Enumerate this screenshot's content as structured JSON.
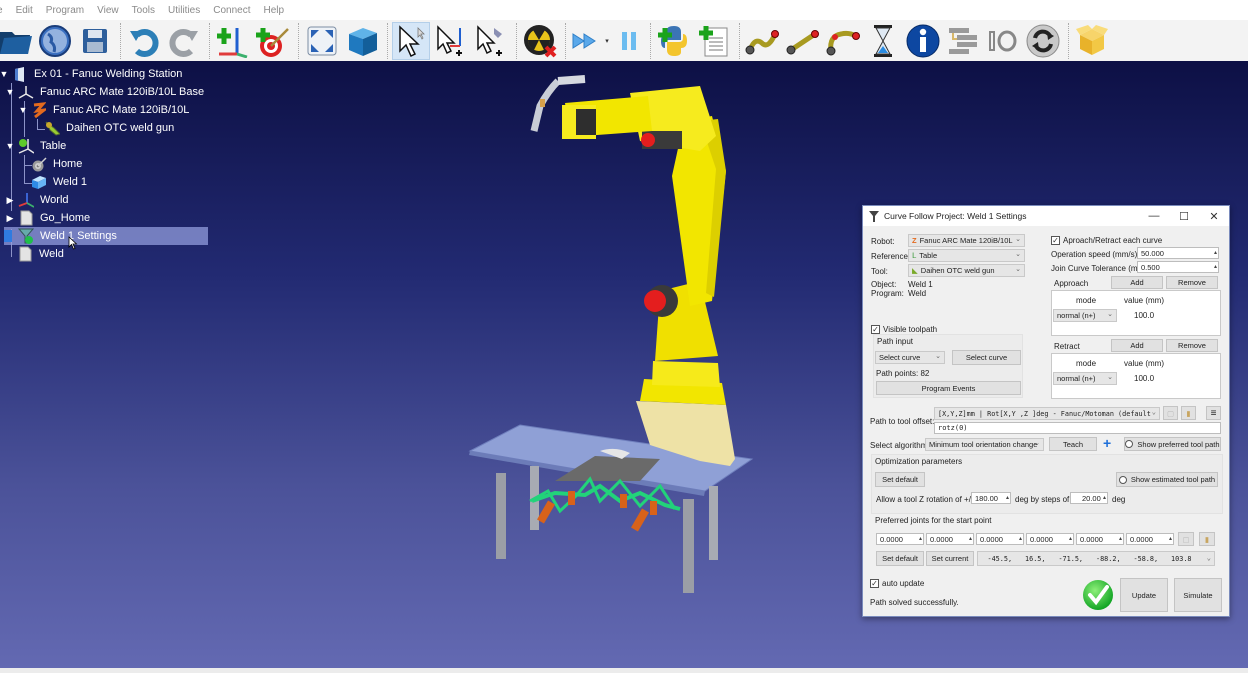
{
  "menu": [
    "e",
    "Edit",
    "Program",
    "View",
    "Tools",
    "Utilities",
    "Connect",
    "Help"
  ],
  "toolbar": [
    {
      "name": "open-folder-icon"
    },
    {
      "name": "online-library-icon"
    },
    {
      "name": "save-icon"
    },
    {
      "name": "undo-icon"
    },
    {
      "name": "redo-icon"
    },
    {
      "name": "add-reference-frame-icon"
    },
    {
      "name": "add-target-icon"
    },
    {
      "name": "fit-all-icon"
    },
    {
      "name": "iso-view-icon"
    },
    {
      "name": "select-pointer-icon",
      "active": true
    },
    {
      "name": "move-reference-icon"
    },
    {
      "name": "move-tool-icon"
    },
    {
      "name": "collision-check-icon"
    },
    {
      "name": "fast-forward-icon"
    },
    {
      "name": "pause-icon"
    },
    {
      "name": "add-python-program-icon"
    },
    {
      "name": "add-program-icon"
    },
    {
      "name": "joint-move-icon"
    },
    {
      "name": "linear-move-icon"
    },
    {
      "name": "circular-move-icon"
    },
    {
      "name": "pause-instruction-icon"
    },
    {
      "name": "show-message-icon"
    },
    {
      "name": "program-call-icon"
    },
    {
      "name": "set-io-icon"
    },
    {
      "name": "simulation-sync-icon"
    },
    {
      "name": "add-station-object-icon"
    }
  ],
  "tree": {
    "root": "Ex 01 - Fanuc Welding Station",
    "base": "Fanuc ARC Mate 120iB/10L Base",
    "robot": "Fanuc ARC Mate 120iB/10L",
    "tool": "Daihen OTC weld gun",
    "table": "Table",
    "home": "Home",
    "weld1": "Weld 1",
    "world": "World",
    "go_home": "Go_Home",
    "weld1_settings": "Weld 1 Settings",
    "weld": "Weld"
  },
  "dialog": {
    "title": "Curve Follow Project: Weld 1 Settings",
    "robot_label": "Robot:",
    "robot_value": "Fanuc ARC Mate 120iB/10L",
    "reference_label": "Reference:",
    "reference_value": "Table",
    "tool_label": "Tool:",
    "tool_value": "Daihen OTC weld gun",
    "object_label": "Object:",
    "object_value": "Weld 1",
    "program_label": "Program:",
    "program_value": "Weld",
    "approach_retract_each_curve": "Aproach/Retract each curve",
    "approach_retract_checked": true,
    "operation_speed_label": "Operation speed (mm/s)",
    "operation_speed_value": "50.000",
    "join_tolerance_label": "Join Curve Tolerance (mm)",
    "join_tolerance_value": "0.500",
    "approach": {
      "label": "Approach",
      "add": "Add",
      "remove": "Remove",
      "col_mode": "mode",
      "col_value": "value (mm)",
      "mode": "normal (n+)",
      "value": "100.0"
    },
    "retract": {
      "label": "Retract",
      "add": "Add",
      "remove": "Remove",
      "col_mode": "mode",
      "col_value": "value (mm)",
      "mode": "normal (n+)",
      "value": "100.0"
    },
    "visible_toolpath": "Visible toolpath",
    "visible_toolpath_checked": true,
    "path_input_label": "Path input",
    "select_curve_combo": "Select curve",
    "select_curve_button": "Select curve",
    "path_points": "Path points: 82",
    "program_events": "Program Events",
    "path_to_tool_offset_label": "Path to tool offset:",
    "offset_format": "[X,Y,Z]mm | Rot[X,Y ,Z  ]deg - Fanuc/Motoman (default",
    "offset_value": "rotz(0)",
    "select_algorithm_label": "Select algorithm:",
    "algorithm_value": "Minimum tool orientation change",
    "teach": "Teach",
    "show_preferred_tool_path": "Show preferred tool path",
    "optimization_parameters": "Optimization parameters",
    "set_default": "Set default",
    "show_estimated_tool_path": "Show estimated tool path",
    "allow_rotation_label": "Allow a tool Z rotation of +/-",
    "rotation_value": "180.00",
    "deg_by_steps": "deg by steps of",
    "step_value": "20.00",
    "deg": "deg",
    "preferred_joints_label": "Preferred joints for the start point",
    "joints": [
      "0.0000",
      "0.0000",
      "0.0000",
      "0.0000",
      "0.0000",
      "0.0000"
    ],
    "set_default_joints": "Set default",
    "set_current": "Set current",
    "current_joints": [
      "-45.5,",
      "16.5,",
      "-71.5,",
      "-88.2,",
      "-58.8,",
      "103.8"
    ],
    "auto_update": "auto update",
    "auto_update_checked": true,
    "status": "Path solved successfully.",
    "update": "Update",
    "simulate": "Simulate"
  },
  "colors": {
    "robot_yellow": "#f2e600",
    "toolpath_green": "#22d37a",
    "selection": "#929cdc"
  }
}
